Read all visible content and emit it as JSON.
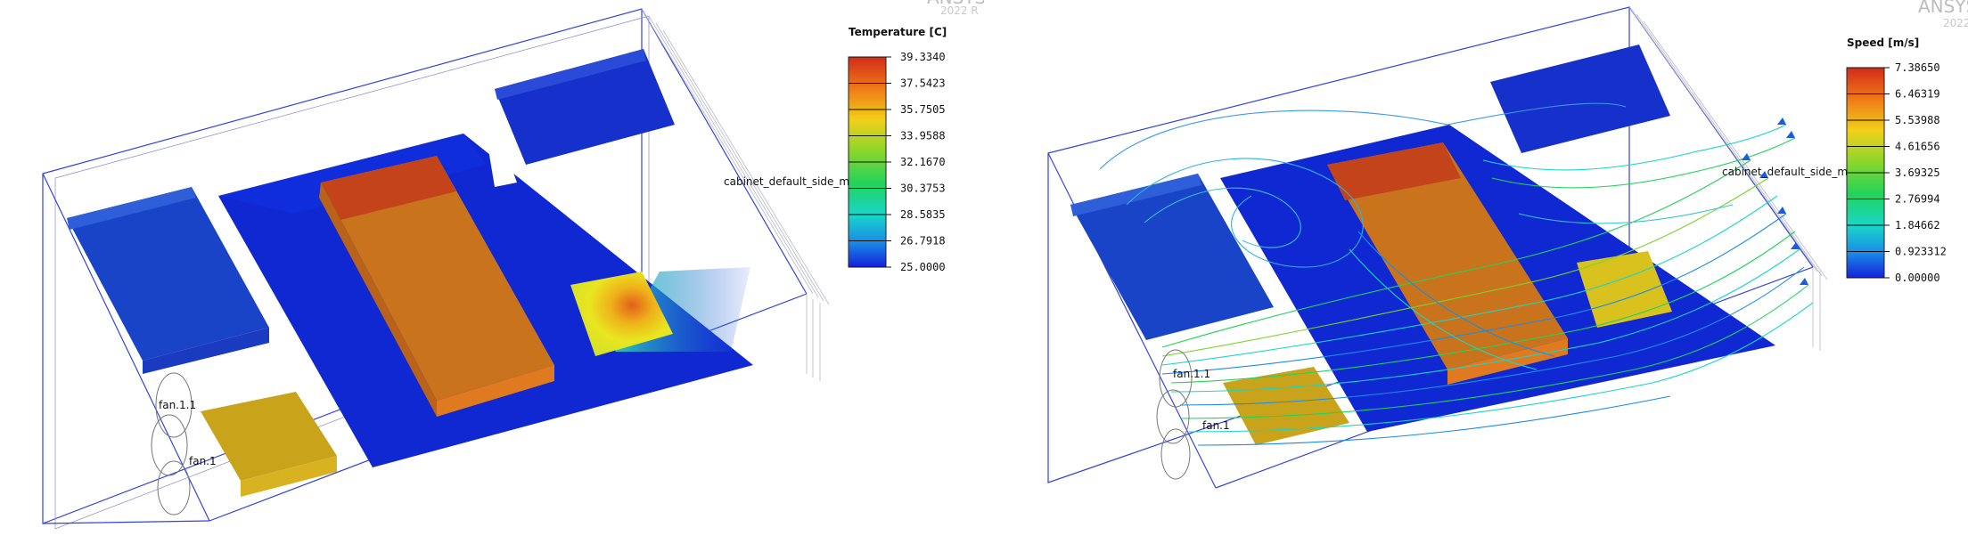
{
  "left_view": {
    "legend": {
      "title": "Temperature [C]",
      "ticks": [
        "39.3340",
        "37.5423",
        "35.7505",
        "33.9588",
        "32.1670",
        "30.3753",
        "28.5835",
        "26.7918",
        "25.0000"
      ],
      "colors": [
        "#d32b1a",
        "#e46a16",
        "#f0a818",
        "#f2e21a",
        "#7ad42a",
        "#22d35c",
        "#19d6c8",
        "#1a8ce8",
        "#1322d9"
      ]
    },
    "labels": {
      "cabinet": "cabinet_default_side_m",
      "fan1_1": "fan.1.1",
      "fan1": "fan.1"
    },
    "watermark": "2022 R"
  },
  "right_view": {
    "legend": {
      "title": "Speed [m/s]",
      "ticks": [
        "7.38650",
        "6.46319",
        "5.53988",
        "4.61656",
        "3.69325",
        "2.76994",
        "1.84662",
        "0.923312",
        "0.00000"
      ],
      "colors": [
        "#d32b1a",
        "#e46a16",
        "#f0a818",
        "#f2e21a",
        "#7ad42a",
        "#22d35c",
        "#19d6c8",
        "#1a8ce8",
        "#1322d9"
      ]
    },
    "labels": {
      "cabinet": "cabinet_default_side_m",
      "fan1_1": "fan.1.1",
      "fan1": "fan.1"
    },
    "watermark_brand": "ANSYS",
    "watermark": "2022 R"
  },
  "colors": {
    "board_blue": "#1028d2",
    "component_blue": "#1a44c8",
    "hot_orange": "#c9741c",
    "hot_red": "#c3441a",
    "fan_block": "#c9a41a",
    "frame_blue": "#3344dd"
  }
}
